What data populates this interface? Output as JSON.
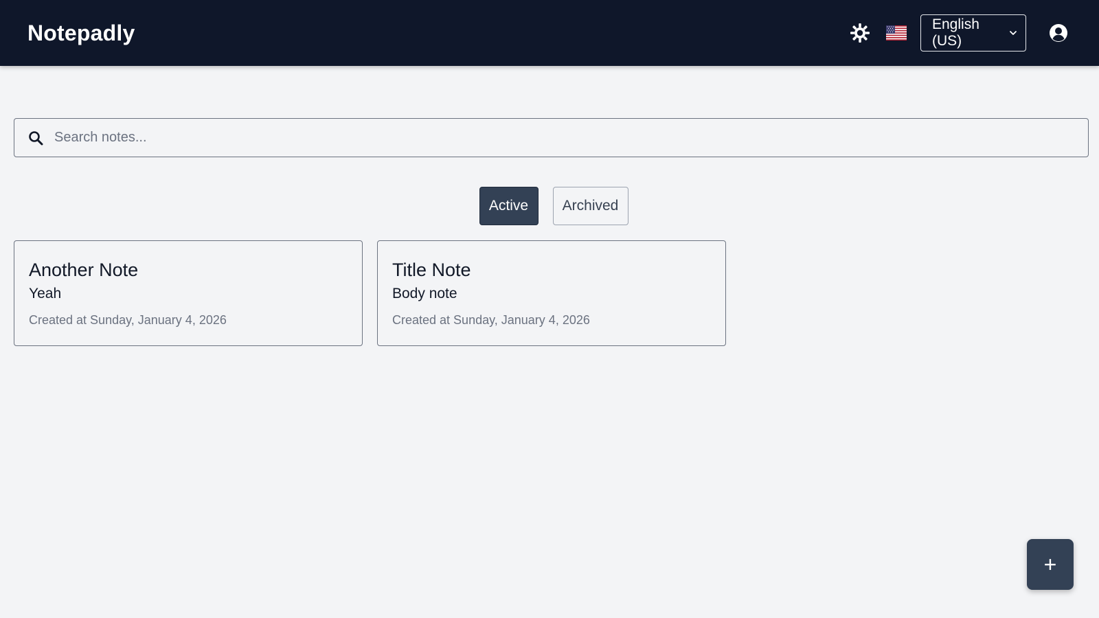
{
  "app": {
    "brand": "Notepadly"
  },
  "header": {
    "theme_icon": "sun-icon",
    "flag_icon": "us-flag-icon",
    "language_selected": "English (US)",
    "account_icon": "user-circle-icon"
  },
  "search": {
    "placeholder": "Search notes...",
    "value": ""
  },
  "tabs": [
    {
      "label": "Active",
      "active": true
    },
    {
      "label": "Archived",
      "active": false
    }
  ],
  "notes": [
    {
      "title": "Another Note",
      "body": "Yeah",
      "created": "Created at Sunday, January 4, 2026"
    },
    {
      "title": "Title Note",
      "body": "Body note",
      "created": "Created at Sunday, January 4, 2026"
    }
  ],
  "fab": {
    "label": "+",
    "icon": "plus-icon"
  },
  "colors": {
    "navbar": "#0f172a",
    "background": "#f3f4f6",
    "accent": "#334155"
  }
}
